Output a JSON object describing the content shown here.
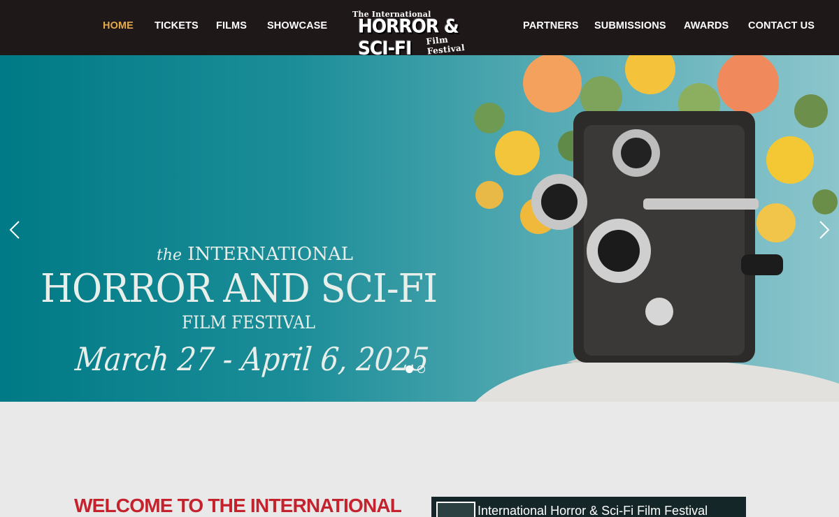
{
  "nav": {
    "left": [
      "HOME",
      "TICKETS",
      "FILMS",
      "SHOWCASE"
    ],
    "right": [
      "PARTNERS",
      "SUBMISSIONS",
      "AWARDS",
      "CONTACT US"
    ],
    "active": "HOME",
    "active_color": "#e4a94d"
  },
  "logo": {
    "line1": "The International",
    "line2": "HORROR & SCI-FI",
    "line3": "Film Festival"
  },
  "hero": {
    "the": "the",
    "international": "INTERNATIONAL",
    "title": "HORROR AND SCI-FI",
    "subtitle": "FILM FESTIVAL",
    "dates": "March 27 - April 6, 2025",
    "slide_count": 2,
    "active_slide": 1,
    "prev_icon": "chevron-left-icon",
    "next_icon": "chevron-right-icon"
  },
  "welcome": {
    "heading": "WELCOME TO THE INTERNATIONAL",
    "color": "#c4232d"
  },
  "video": {
    "title": "International Horror & Sci-Fi Film Festival"
  }
}
